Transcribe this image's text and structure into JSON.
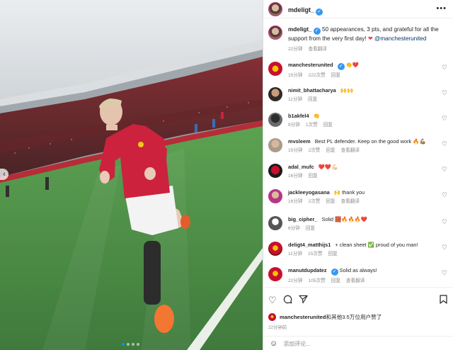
{
  "post": {
    "author": "mdeligt_",
    "caption_text": "50 appearances, 3 pts, and grateful for all the support from the very first day!",
    "caption_emoji": "❤",
    "caption_mention": "@manchesterunited",
    "caption_time": "22分钟",
    "translate_label": "查看翻译"
  },
  "comments": [
    {
      "user": "manchesterunited",
      "verified": true,
      "text": "👏❤️",
      "time": "15分钟",
      "likes": "222次赞",
      "reply": "回复",
      "translate": ""
    },
    {
      "user": "nimit_bhattacharya",
      "verified": false,
      "text": "🙌🙌",
      "time": "11分钟",
      "likes": "",
      "reply": "回复",
      "translate": ""
    },
    {
      "user": "b1akfel4",
      "verified": false,
      "text": "👏",
      "time": "8分钟",
      "likes": "1次赞",
      "reply": "回复",
      "translate": ""
    },
    {
      "user": "mvsleem",
      "verified": false,
      "text": "Best PL defender. Keep on the good work 🔥💪🏽",
      "time": "15分钟",
      "likes": "2次赞",
      "reply": "回复",
      "translate": "查看翻译"
    },
    {
      "user": "adal_mufc",
      "verified": false,
      "text": "❤️❤️💪🏻",
      "time": "16分钟",
      "likes": "",
      "reply": "回复",
      "translate": ""
    },
    {
      "user": "jackleeyogasana",
      "verified": false,
      "text": "🙌 thank you",
      "time": "16分钟",
      "likes": "2次赞",
      "reply": "回复",
      "translate": "查看翻译"
    },
    {
      "user": "big_cipher_",
      "verified": false,
      "text": "Solid 🧱🔥🔥🔥❤️",
      "time": "6分钟",
      "likes": "",
      "reply": "回复",
      "translate": ""
    },
    {
      "user": "deligt4_matthijs1",
      "verified": false,
      "text": "+ clean sheet ✅ proud of you man!",
      "time": "11分钟",
      "likes": "15次赞",
      "reply": "回复",
      "translate": ""
    },
    {
      "user": "manutdupdatez",
      "verified": true,
      "text": "Solid as always!",
      "time": "22分钟",
      "likes": "105次赞",
      "reply": "回复",
      "translate": "查看翻译"
    }
  ],
  "footer": {
    "likes_user": "manchesterunited",
    "likes_rest": "和其他3.5万位用户赞了",
    "time": "22分钟前",
    "add_comment_placeholder": "添加评论..."
  },
  "icons": {
    "like": "heart-outline-icon",
    "comment": "comment-bubble-icon",
    "share": "paper-plane-icon",
    "save": "bookmark-icon",
    "more": "more-dots-icon",
    "emoji": "smiley-icon"
  },
  "colors": {
    "verified": "#3897f0",
    "jersey_red": "#c8102e",
    "pitch_green": "#3d8a3a",
    "link": "#00376b"
  }
}
